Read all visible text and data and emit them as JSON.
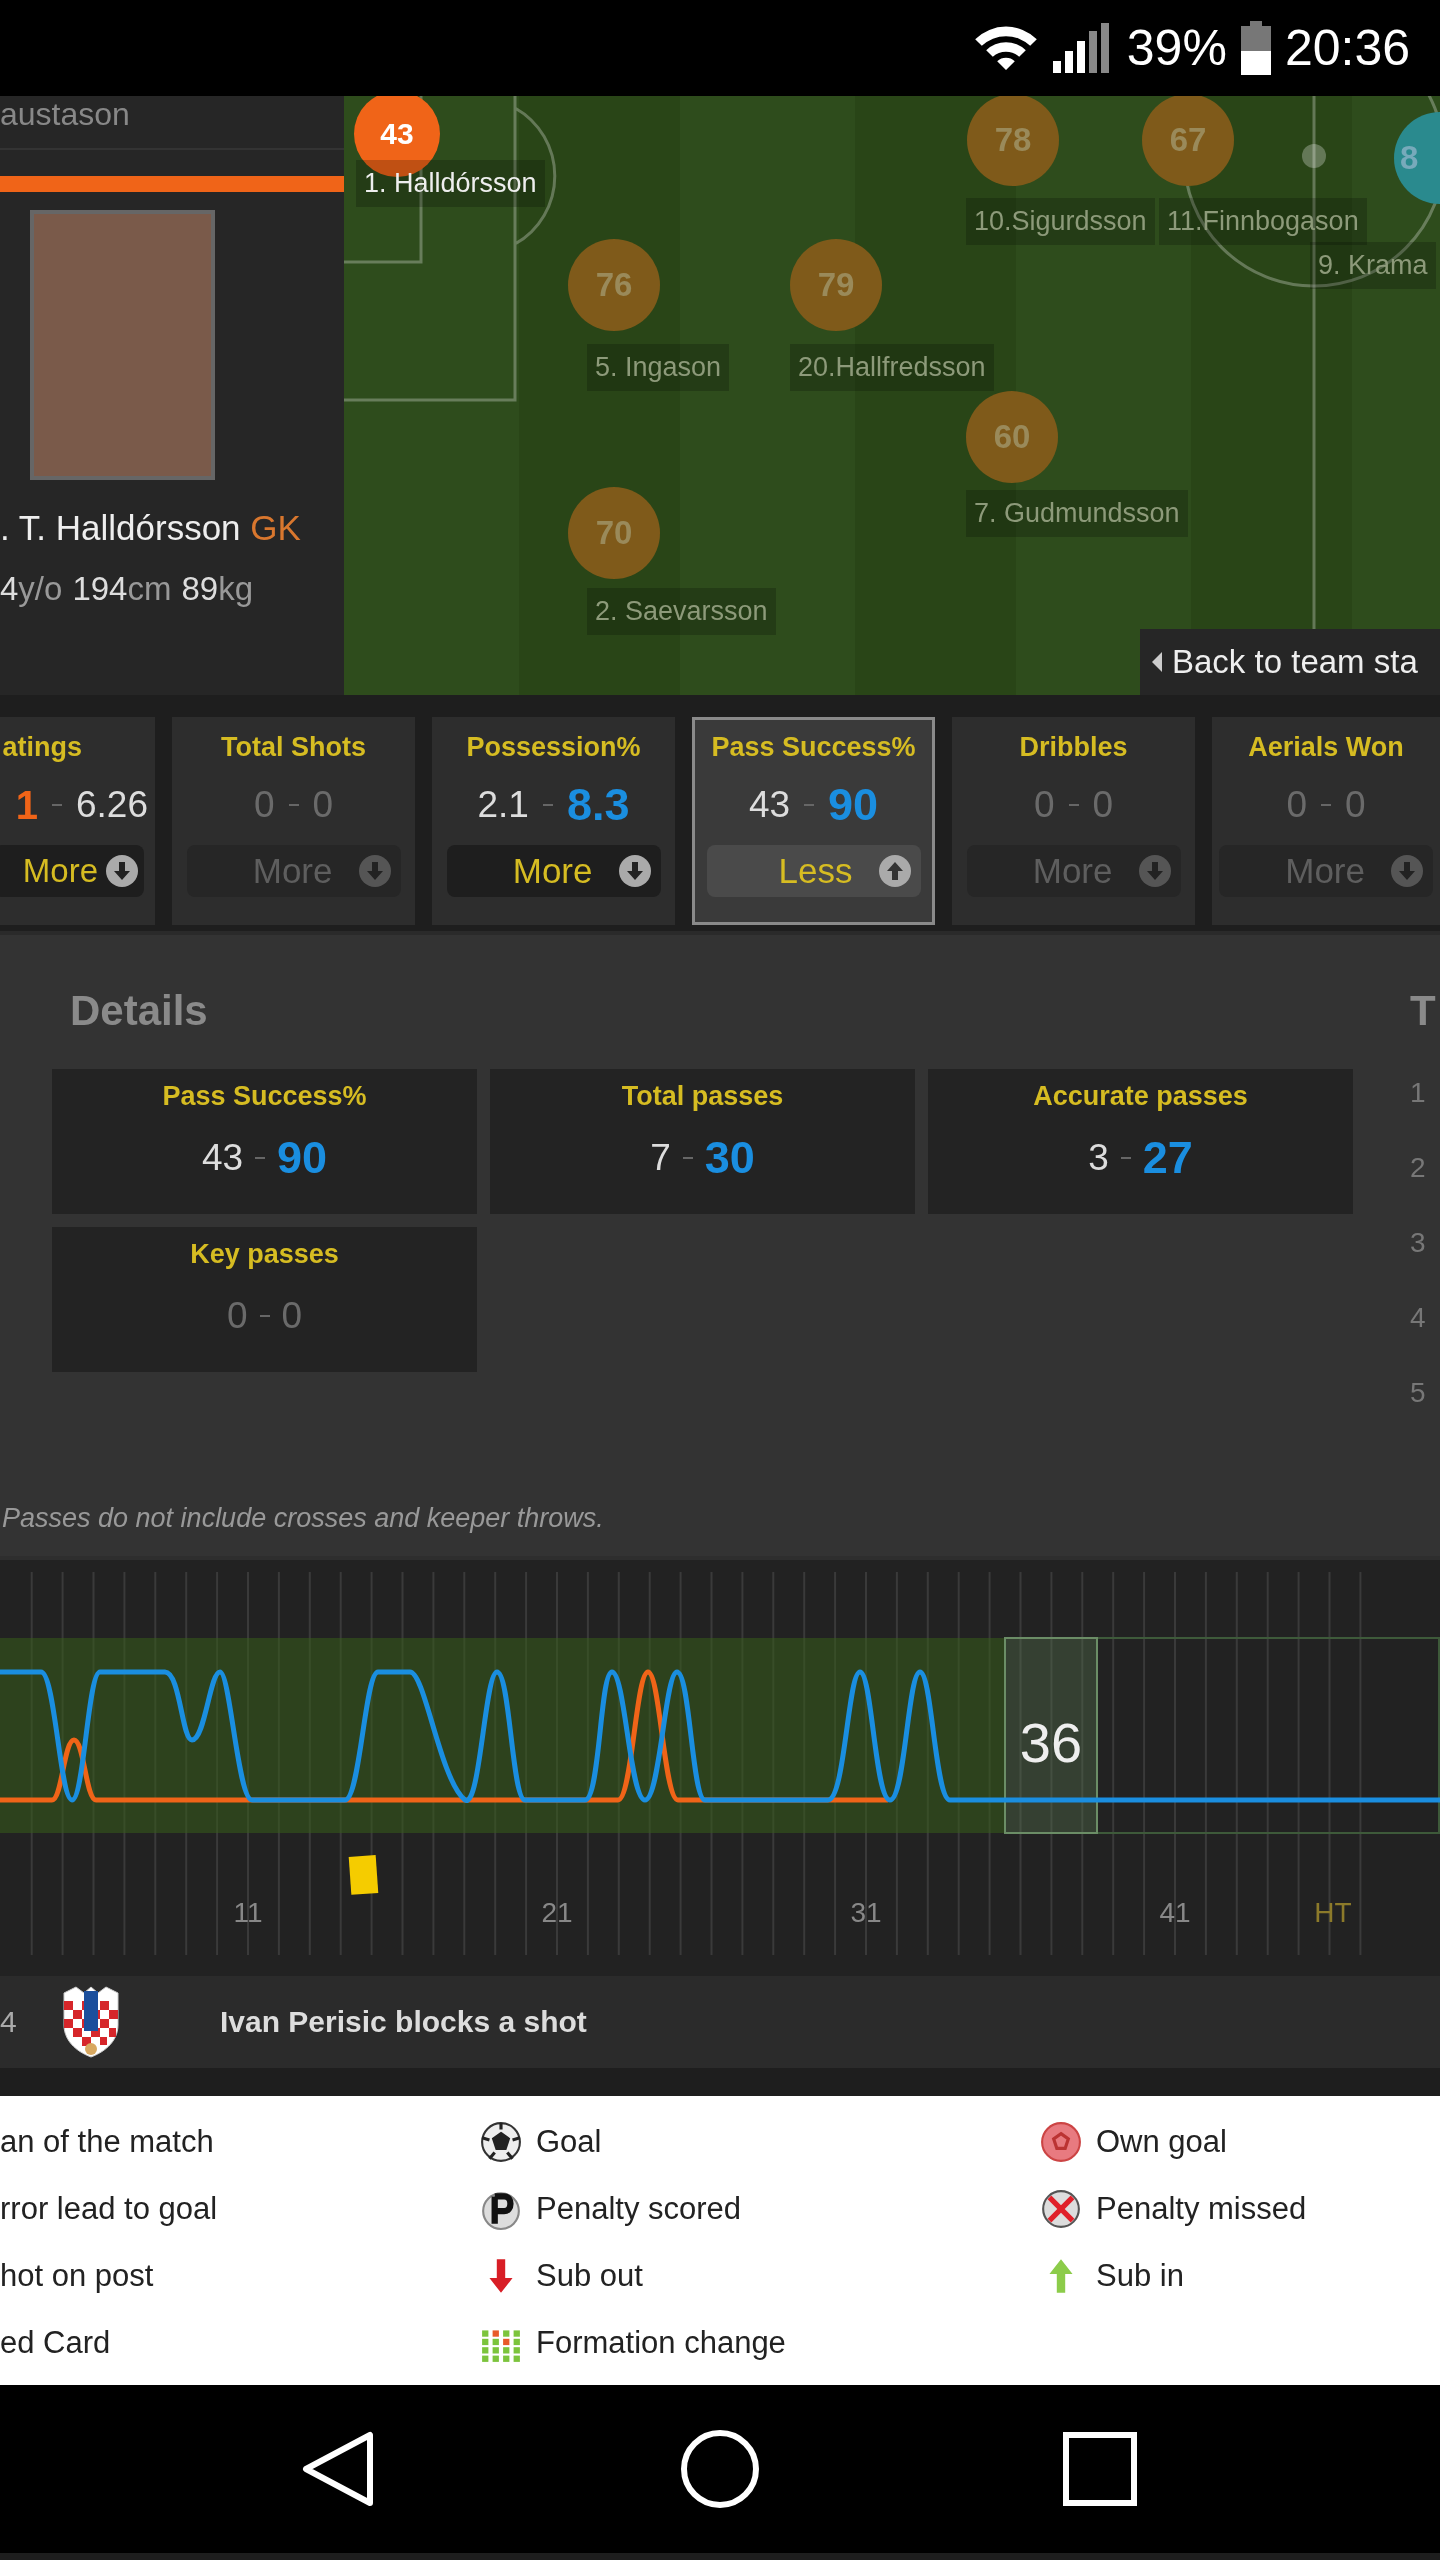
{
  "status_bar": {
    "battery": "39%",
    "time": "20:36"
  },
  "player_panel": {
    "list_item": "austason",
    "name": ". T. Halldórsson",
    "position": "GK",
    "details": [
      {
        "value": "4",
        "unit": "y/o"
      },
      {
        "value": "194",
        "unit": "cm"
      },
      {
        "value": "89",
        "unit": "kg"
      }
    ]
  },
  "pitch": {
    "players": [
      {
        "number": "43",
        "label": "1. Halldórsson",
        "selected": true,
        "color": "#f06418"
      },
      {
        "number": "78",
        "label": "10.Sigurdsson",
        "selected": false,
        "color": "#7f5a1a"
      },
      {
        "number": "67",
        "label": "11.Finnbogason",
        "selected": false,
        "color": "#7f5a1a"
      },
      {
        "number": "8",
        "label": "9. Krama",
        "selected": false,
        "color": "#2a8a8e"
      },
      {
        "number": "76",
        "label": "5. Ingason",
        "selected": false,
        "color": "#7f5a1a"
      },
      {
        "number": "79",
        "label": "20.Hallfredsson",
        "selected": false,
        "color": "#7f5a1a"
      },
      {
        "number": "60",
        "label": "7. Gudmundsson",
        "selected": false,
        "color": "#7f5a1a"
      },
      {
        "number": "70",
        "label": "2. Saevarsson",
        "selected": false,
        "color": "#7f5a1a"
      }
    ],
    "back_button": "Back to team sta"
  },
  "stat_cards": [
    {
      "title": "atings",
      "home": "1",
      "away": "6.26",
      "home_highlight": true,
      "away_highlight": false,
      "muted": false,
      "button": "More",
      "selected": false
    },
    {
      "title": "Total Shots",
      "home": "0",
      "away": "0",
      "muted": true,
      "button": "More",
      "selected": false
    },
    {
      "title": "Possession%",
      "home": "2.1",
      "away": "8.3",
      "home_highlight": false,
      "away_highlight": true,
      "muted": false,
      "button": "More",
      "selected": false
    },
    {
      "title": "Pass Success%",
      "home": "43",
      "away": "90",
      "home_highlight": false,
      "away_highlight": true,
      "muted": false,
      "button": "Less",
      "selected": true
    },
    {
      "title": "Dribbles",
      "home": "0",
      "away": "0",
      "muted": true,
      "button": "More",
      "selected": false
    },
    {
      "title": "Aerials Won",
      "home": "0",
      "away": "0",
      "muted": true,
      "button": "More",
      "selected": false
    }
  ],
  "details": {
    "title": "Details",
    "tiles": [
      {
        "title": "Pass Success%",
        "home": "43",
        "away": "90",
        "away_highlight": true,
        "muted": false
      },
      {
        "title": "Total passes",
        "home": "7",
        "away": "30",
        "away_highlight": true,
        "muted": false
      },
      {
        "title": "Accurate passes",
        "home": "3",
        "away": "27",
        "away_highlight": true,
        "muted": false
      },
      {
        "title": "Key passes",
        "home": "0",
        "away": "0",
        "muted": true
      }
    ],
    "side_column": {
      "title": "T",
      "items": [
        "1",
        "2",
        "3",
        "4",
        "5"
      ]
    },
    "footnote": "Passes do not include crosses and keeper throws."
  },
  "timeline": {
    "current_minute": "36",
    "ticks": [
      {
        "label": "11",
        "kind": "minute"
      },
      {
        "label": "21",
        "kind": "minute"
      },
      {
        "label": "31",
        "kind": "minute"
      },
      {
        "label": "41",
        "kind": "minute"
      },
      {
        "label": "HT",
        "kind": "half"
      }
    ]
  },
  "event": {
    "minute": "4",
    "text": "Ivan Perisic blocks a shot"
  },
  "legend": [
    {
      "kind": "none",
      "label": "an of the match"
    },
    {
      "kind": "goal",
      "label": "Goal"
    },
    {
      "kind": "own-goal",
      "label": "Own goal"
    },
    {
      "kind": "none",
      "label": "rror lead to goal"
    },
    {
      "kind": "penalty-scored",
      "label": "Penalty scored"
    },
    {
      "kind": "penalty-missed",
      "label": "Penalty missed"
    },
    {
      "kind": "none",
      "label": "hot on post"
    },
    {
      "kind": "sub-out",
      "label": "Sub out"
    },
    {
      "kind": "sub-in",
      "label": "Sub in"
    },
    {
      "kind": "none",
      "label": "ed Card"
    },
    {
      "kind": "formation",
      "label": "Formation change"
    }
  ]
}
